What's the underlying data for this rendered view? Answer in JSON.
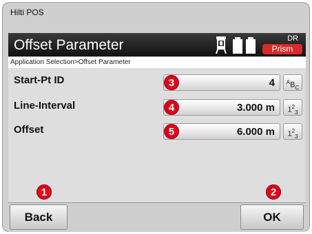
{
  "window": {
    "app_title": "Hilti POS"
  },
  "header": {
    "title": "Offset Parameter",
    "status": {
      "mode": "DR",
      "target": "Prism",
      "target_color": "#d82b2b"
    }
  },
  "breadcrumb": "Application Selection>Offset Parameter",
  "fields": [
    {
      "label": "Start-Pt ID",
      "value": "4",
      "badge": "3",
      "input_mode": "alpha"
    },
    {
      "label": "Line-Interval",
      "value": "3.000 m",
      "badge": "4",
      "input_mode": "numeric"
    },
    {
      "label": "Offset",
      "value": "6.000 m",
      "badge": "5",
      "input_mode": "numeric"
    }
  ],
  "buttons": {
    "back": "Back",
    "ok": "OK"
  },
  "callouts": {
    "back": "1",
    "ok": "2"
  },
  "icons": {
    "instrument": "total-station-icon",
    "battery": "battery-icon",
    "alpha_mode": "alpha-input-icon",
    "numeric_mode": "numeric-input-icon"
  },
  "colors": {
    "accent": "#e1001a",
    "title_bar": "#111111"
  }
}
